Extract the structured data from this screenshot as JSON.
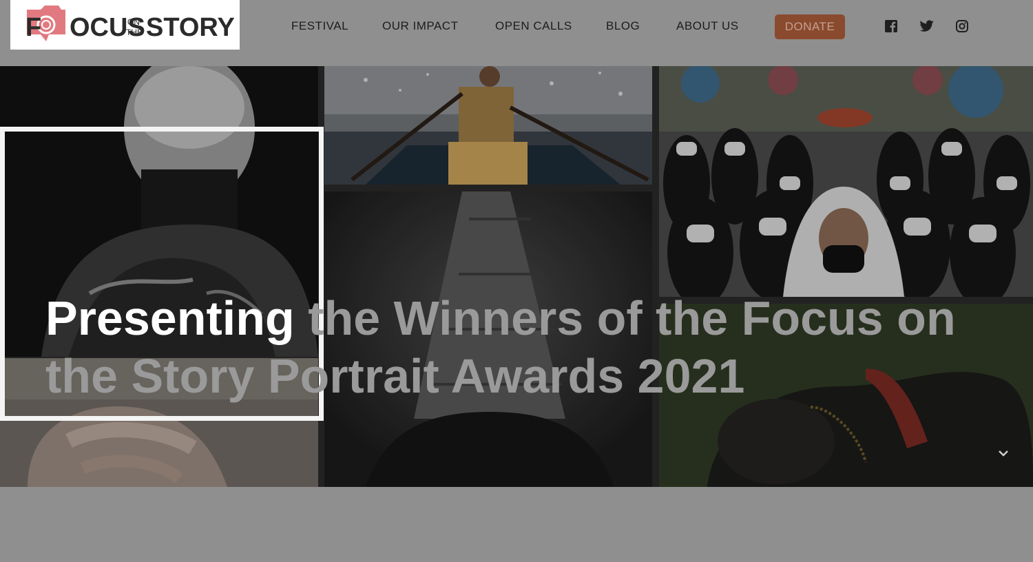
{
  "logo": {
    "text_focus": "FOCUS",
    "text_on": "ON",
    "text_the": "THE",
    "text_story": "STORY"
  },
  "nav": {
    "items": [
      {
        "label": "FESTIVAL"
      },
      {
        "label": "OUR IMPACT"
      },
      {
        "label": "OPEN CALLS"
      },
      {
        "label": "BLOG"
      },
      {
        "label": "ABOUT US"
      }
    ],
    "donate_label": "DONATE"
  },
  "social": {
    "icons": [
      "facebook-icon",
      "twitter-icon",
      "instagram-icon"
    ]
  },
  "hero": {
    "headline_highlight": "Presenting",
    "headline_rest": " the Winners of the Focus on the Story Portrait Awards 2021"
  },
  "colors": {
    "brand_red": "#d9474f",
    "donate_bg": "#8a4a2e",
    "header_bg": "#8f8f8f"
  }
}
